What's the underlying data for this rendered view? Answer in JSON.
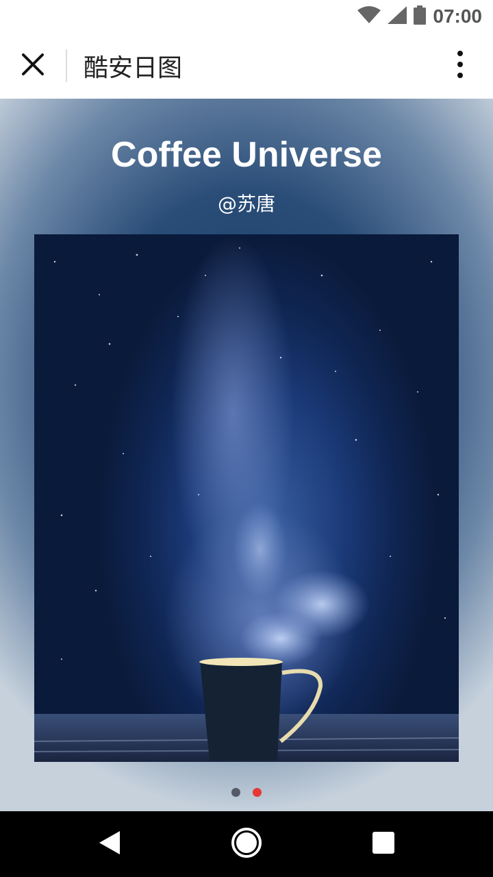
{
  "status_bar": {
    "time": "07:00",
    "icons": [
      "wifi-icon",
      "signal-icon",
      "battery-icon"
    ]
  },
  "app_bar": {
    "title": "酷安日图",
    "close_icon": "close-icon",
    "more_icon": "more-vert-icon"
  },
  "card": {
    "title": "Coffee Universe",
    "author": "@苏唐",
    "image_subject": "steaming coffee mug under starry night sky"
  },
  "pager": {
    "total": 2,
    "active_index": 1,
    "inactive_color": "#555b66",
    "active_color": "#e53935"
  },
  "nav_bar": {
    "buttons": [
      "back-icon",
      "home-icon",
      "recents-icon"
    ]
  }
}
